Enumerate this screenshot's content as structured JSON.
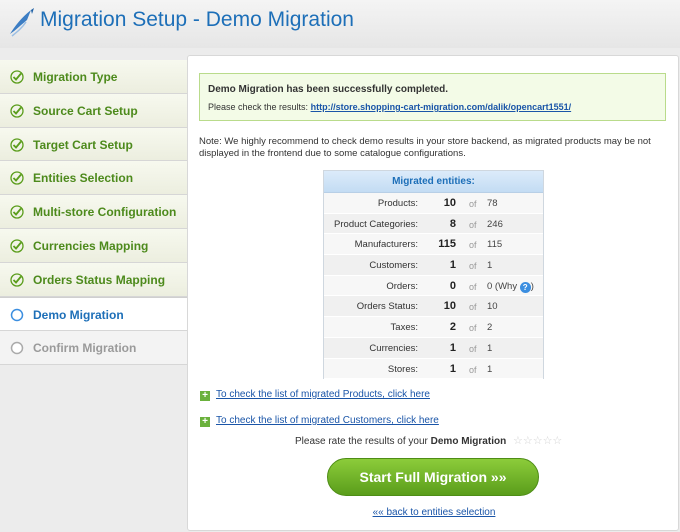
{
  "header": {
    "title": "Migration Setup - Demo Migration"
  },
  "sidebar": {
    "steps": [
      {
        "label": "Migration Type",
        "state": "done"
      },
      {
        "label": "Source Cart Setup",
        "state": "done"
      },
      {
        "label": "Target Cart Setup",
        "state": "done"
      },
      {
        "label": "Entities Selection",
        "state": "done"
      },
      {
        "label": "Multi-store Configuration",
        "state": "done"
      },
      {
        "label": "Currencies Mapping",
        "state": "done"
      },
      {
        "label": "Orders Status Mapping",
        "state": "done"
      },
      {
        "label": "Demo Migration",
        "state": "active"
      },
      {
        "label": "Confirm Migration",
        "state": "todo"
      }
    ]
  },
  "success": {
    "title": "Demo Migration has been successfully completed.",
    "prefix": "Please check the results:",
    "link": "http://store.shopping-cart-migration.com/dalik/opencart1551/"
  },
  "note": "Note: We highly recommend to check demo results in your store backend, as migrated products may be not displayed in the frontend due to some catalogue configurations.",
  "entities": {
    "header": "Migrated entities:",
    "of_label": "of",
    "rows": [
      {
        "name": "Products:",
        "value": "10",
        "total": "78"
      },
      {
        "name": "Product Categories:",
        "value": "8",
        "total": "246"
      },
      {
        "name": "Manufacturers:",
        "value": "115",
        "total": "115"
      },
      {
        "name": "Customers:",
        "value": "1",
        "total": "1"
      },
      {
        "name": "Orders:",
        "value": "0",
        "total": "0 (Why",
        "help": "?"
      },
      {
        "name": "Orders Status:",
        "value": "10",
        "total": "10"
      },
      {
        "name": "Taxes:",
        "value": "2",
        "total": "2"
      },
      {
        "name": "Currencies:",
        "value": "1",
        "total": "1"
      },
      {
        "name": "Stores:",
        "value": "1",
        "total": "1"
      }
    ]
  },
  "links": {
    "products": "To check the list of migrated Products, click here",
    "customers": "To check the list of migrated Customers, click here"
  },
  "rating": {
    "prefix": "Please rate the results of your",
    "subject": "Demo Migration",
    "stars": "☆☆☆☆☆"
  },
  "buttons": {
    "start": "Start Full Migration »»",
    "back": "«« back to entities selection"
  },
  "colors": {
    "accent_blue": "#1d6fb8",
    "done_green": "#4d8a1c",
    "button_green": "#6ab13c"
  }
}
